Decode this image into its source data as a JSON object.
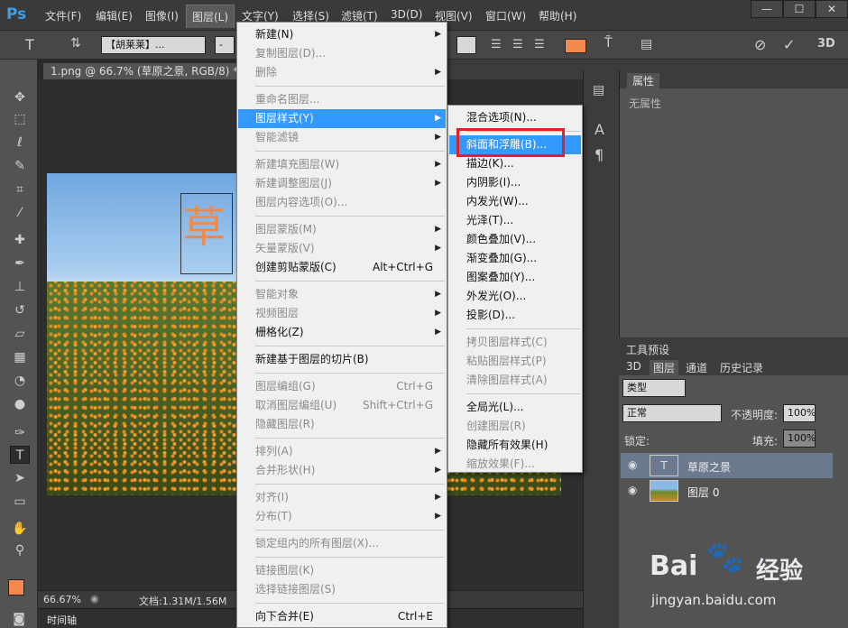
{
  "app": {
    "logo": "Ps"
  },
  "menubar": {
    "items": [
      "文件(F)",
      "编辑(E)",
      "图像(I)",
      "图层(L)",
      "文字(Y)",
      "选择(S)",
      "滤镜(T)",
      "3D(D)",
      "视图(V)",
      "窗口(W)",
      "帮助(H)"
    ],
    "window_buttons": [
      "—",
      "☐",
      "✕"
    ]
  },
  "options": {
    "font_family": "【胡莱莱】...",
    "font_style": "-",
    "color_swatch": "#f4894e"
  },
  "document": {
    "tab_label": "1.png @ 66.7% (草原之景, RGB/8) *",
    "text_layer_glyph": "草",
    "zoom": "66.67%",
    "doc_info": "文档:1.31M/1.56M",
    "timeline_label": "时间轴"
  },
  "panels": {
    "properties_tab": "属性",
    "properties_empty": "无属性",
    "tool_presets_tab": "工具预设",
    "layers_tabs": [
      "3D",
      "图层",
      "通道",
      "历史记录"
    ],
    "filter_kind": "类型",
    "blend_mode": "正常",
    "opacity_label": "不透明度:",
    "opacity_value": "100%",
    "lock_label": "锁定:",
    "fill_label": "填充:",
    "fill_value": "100%",
    "layers": [
      {
        "name": "草原之景",
        "type": "text",
        "thumb": "T"
      },
      {
        "name": "图层 0",
        "type": "image"
      }
    ]
  },
  "layer_menu": [
    {
      "label": "新建(N)",
      "arrow": true,
      "disabled": false
    },
    {
      "label": "复制图层(D)...",
      "disabled": true
    },
    {
      "label": "删除",
      "arrow": true,
      "disabled": true
    },
    {
      "sep": true
    },
    {
      "label": "重命名图层...",
      "disabled": true
    },
    {
      "label": "图层样式(Y)",
      "arrow": true,
      "highlight": true
    },
    {
      "label": "智能滤镜",
      "arrow": true,
      "disabled": true
    },
    {
      "sep": true
    },
    {
      "label": "新建填充图层(W)",
      "arrow": true,
      "disabled": true
    },
    {
      "label": "新建调整图层(J)",
      "arrow": true,
      "disabled": true
    },
    {
      "label": "图层内容选项(O)...",
      "disabled": true
    },
    {
      "sep": true
    },
    {
      "label": "图层蒙版(M)",
      "arrow": true,
      "disabled": true
    },
    {
      "label": "矢量蒙版(V)",
      "arrow": true,
      "disabled": true
    },
    {
      "label": "创建剪贴蒙版(C)",
      "shortcut": "Alt+Ctrl+G",
      "disabled": false
    },
    {
      "sep": true
    },
    {
      "label": "智能对象",
      "arrow": true,
      "disabled": true
    },
    {
      "label": "视频图层",
      "arrow": true,
      "disabled": true
    },
    {
      "label": "栅格化(Z)",
      "arrow": true,
      "disabled": false
    },
    {
      "sep": true
    },
    {
      "label": "新建基于图层的切片(B)",
      "disabled": false
    },
    {
      "sep": true
    },
    {
      "label": "图层编组(G)",
      "shortcut": "Ctrl+G",
      "disabled": true
    },
    {
      "label": "取消图层编组(U)",
      "shortcut": "Shift+Ctrl+G",
      "disabled": true
    },
    {
      "label": "隐藏图层(R)",
      "disabled": true
    },
    {
      "sep": true
    },
    {
      "label": "排列(A)",
      "arrow": true,
      "disabled": true
    },
    {
      "label": "合并形状(H)",
      "arrow": true,
      "disabled": true
    },
    {
      "sep": true
    },
    {
      "label": "对齐(I)",
      "arrow": true,
      "disabled": true
    },
    {
      "label": "分布(T)",
      "arrow": true,
      "disabled": true
    },
    {
      "sep": true
    },
    {
      "label": "锁定组内的所有图层(X)...",
      "disabled": true
    },
    {
      "sep": true
    },
    {
      "label": "链接图层(K)",
      "disabled": true
    },
    {
      "label": "选择链接图层(S)",
      "disabled": true
    },
    {
      "sep": true
    },
    {
      "label": "向下合并(E)",
      "shortcut": "Ctrl+E",
      "disabled": false
    }
  ],
  "style_submenu": [
    {
      "label": "混合选项(N)...",
      "disabled": false
    },
    {
      "sep": true
    },
    {
      "label": "斜面和浮雕(B)...",
      "highlight": true
    },
    {
      "label": "描边(K)...",
      "disabled": false
    },
    {
      "label": "内阴影(I)...",
      "disabled": false
    },
    {
      "label": "内发光(W)...",
      "disabled": false
    },
    {
      "label": "光泽(T)...",
      "disabled": false
    },
    {
      "label": "颜色叠加(V)...",
      "disabled": false
    },
    {
      "label": "渐变叠加(G)...",
      "disabled": false
    },
    {
      "label": "图案叠加(Y)...",
      "disabled": false
    },
    {
      "label": "外发光(O)...",
      "disabled": false
    },
    {
      "label": "投影(D)...",
      "disabled": false
    },
    {
      "sep": true
    },
    {
      "label": "拷贝图层样式(C)",
      "disabled": true
    },
    {
      "label": "粘贴图层样式(P)",
      "disabled": true
    },
    {
      "label": "清除图层样式(A)",
      "disabled": true
    },
    {
      "sep": true
    },
    {
      "label": "全局光(L)...",
      "disabled": false
    },
    {
      "label": "创建图层(R)",
      "disabled": true
    },
    {
      "label": "隐藏所有效果(H)",
      "disabled": false
    },
    {
      "label": "缩放效果(F)...",
      "disabled": true
    }
  ],
  "watermark": {
    "brand": "Bai",
    "brand2": "经验",
    "url": "jingyan.baidu.com"
  }
}
